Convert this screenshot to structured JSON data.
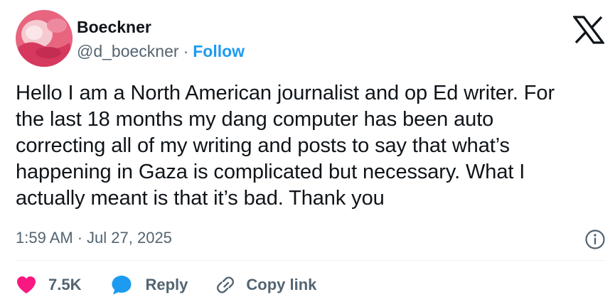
{
  "author": {
    "display_name": "Boeckner",
    "handle": "@d_boeckner",
    "separator": "·",
    "follow_label": "Follow",
    "avatar_icon": "profile-avatar"
  },
  "brand": {
    "logo_icon": "x-logo-icon"
  },
  "tweet": {
    "lines": [
      "Hello I am a North American journalist and op Ed writer. For",
      "the last 18 months my dang computer has been auto",
      "correcting all of my writing and posts to say that what’s",
      "happening in Gaza is complicated but necessary. What I",
      "actually meant is that it’s bad. Thank you"
    ]
  },
  "meta": {
    "time": "1:59 AM",
    "separator": "·",
    "date": "Jul 27, 2025",
    "info_icon": "info-icon"
  },
  "actions": {
    "like_count": "7.5K",
    "like_icon": "heart-icon",
    "reply_label": "Reply",
    "reply_icon": "speech-bubble-icon",
    "copy_label": "Copy link",
    "copy_icon": "link-icon"
  },
  "colors": {
    "accent": "#1d9bf0",
    "like": "#f91880",
    "text_primary": "#0f1419",
    "text_secondary": "#536471"
  }
}
